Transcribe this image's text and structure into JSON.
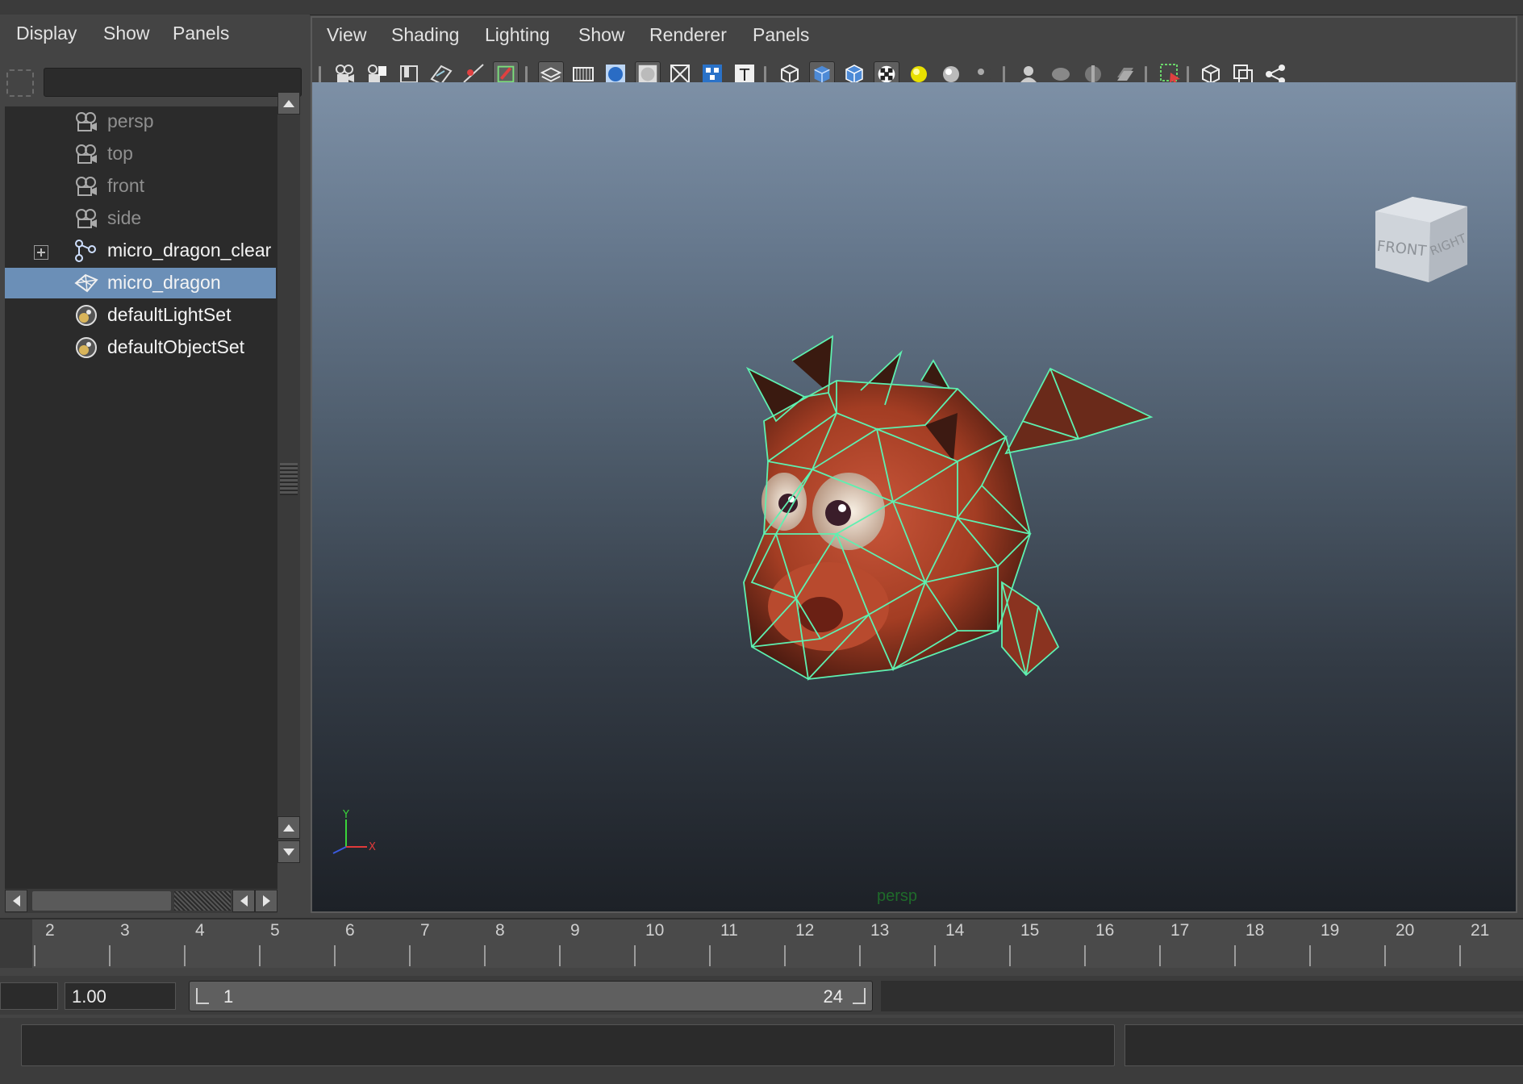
{
  "outliner": {
    "menu": [
      "Display",
      "Show",
      "Panels"
    ],
    "items": [
      {
        "label": "persp",
        "icon": "camera-icon",
        "dim": true
      },
      {
        "label": "top",
        "icon": "camera-icon",
        "dim": true
      },
      {
        "label": "front",
        "icon": "camera-icon",
        "dim": true
      },
      {
        "label": "side",
        "icon": "camera-icon",
        "dim": true
      },
      {
        "label": "micro_dragon_clear",
        "icon": "joint-hierarchy-icon",
        "dim": false,
        "expandable": true
      },
      {
        "label": "micro_dragon",
        "icon": "mesh-icon",
        "dim": false,
        "selected": true
      },
      {
        "label": "defaultLightSet",
        "icon": "set-icon",
        "dim": false
      },
      {
        "label": "defaultObjectSet",
        "icon": "set-icon",
        "dim": false
      }
    ]
  },
  "viewport": {
    "menu": [
      "View",
      "Shading",
      "Lighting",
      "Show",
      "Renderer",
      "Panels"
    ],
    "camera_label": "persp",
    "viewcube": {
      "front": "FRONT",
      "right": "RIGHT"
    },
    "axis": {
      "x": "X",
      "y": "Y"
    },
    "colors": {
      "wireframe": "#5ef0b0",
      "dragon_body": "#b0442a",
      "sky_top": "#7d90a6",
      "sky_bottom": "#1d2127"
    }
  },
  "timeline": {
    "ticks": [
      "2",
      "3",
      "4",
      "5",
      "6",
      "7",
      "8",
      "9",
      "10",
      "11",
      "12",
      "13",
      "14",
      "15",
      "16",
      "17",
      "18",
      "19",
      "20",
      "21"
    ]
  },
  "range": {
    "current": "1.00",
    "start": "1",
    "end": "24"
  },
  "colors": {
    "selection": "#6b8fb7",
    "panel_bg": "#444444",
    "field_bg": "#2b2b2b"
  }
}
